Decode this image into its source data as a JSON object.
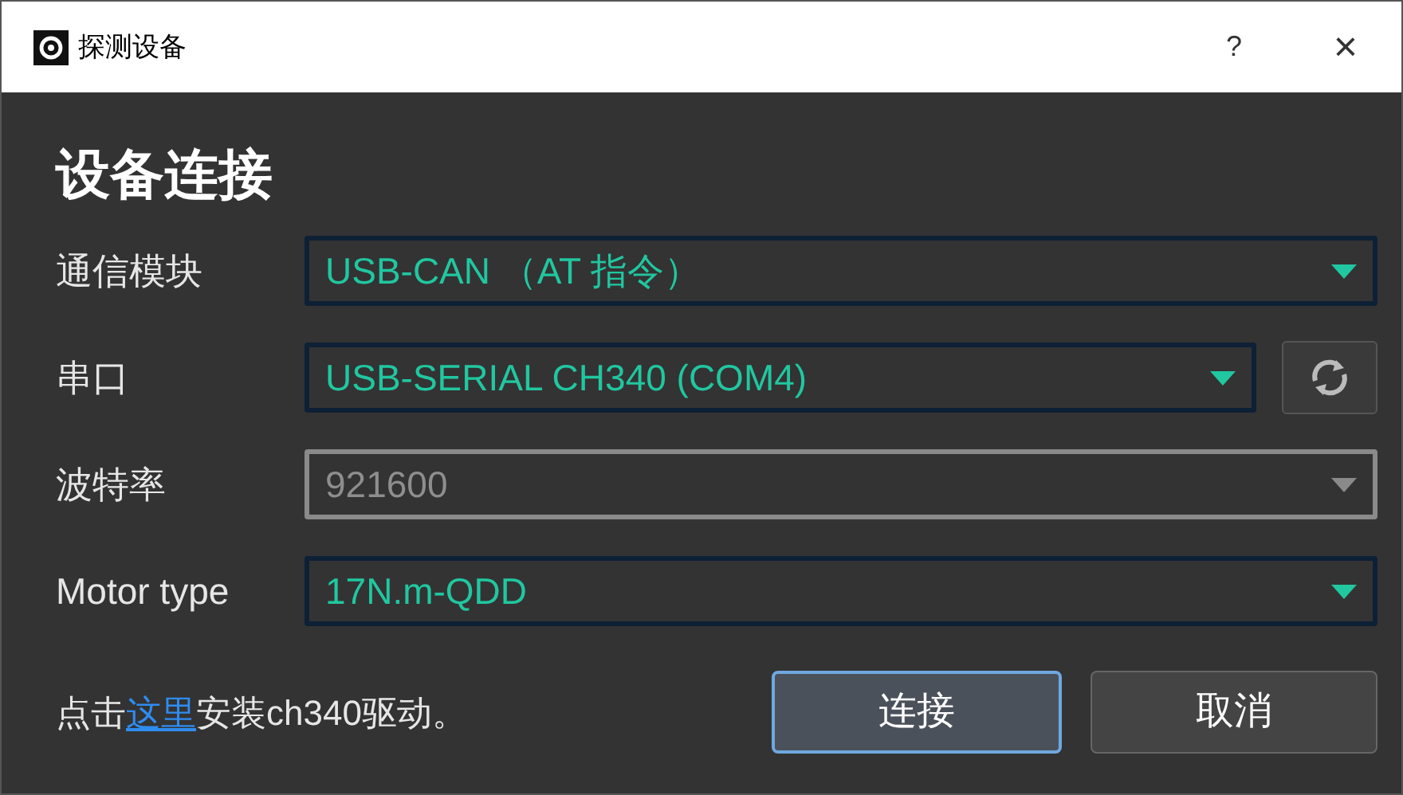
{
  "window": {
    "title": "探测设备",
    "help": "?",
    "close": "×"
  },
  "heading": "设备连接",
  "fields": [
    {
      "label": "通信模块",
      "value": "USB-CAN （AT 指令）",
      "disabled": false,
      "refresh_button": false
    },
    {
      "label": "串口",
      "value": "USB-SERIAL CH340 (COM4)",
      "disabled": false,
      "refresh_button": true
    },
    {
      "label": "波特率",
      "value": "921600",
      "disabled": true,
      "refresh_button": false
    },
    {
      "label": "Motor type",
      "value": "17N.m-QDD",
      "disabled": false,
      "refresh_button": false
    }
  ],
  "hint": {
    "before": "点击",
    "link": "这里",
    "after": "安装ch340驱动。"
  },
  "buttons": [
    {
      "label": "连接",
      "default": true
    },
    {
      "label": "取消",
      "default": false
    }
  ]
}
